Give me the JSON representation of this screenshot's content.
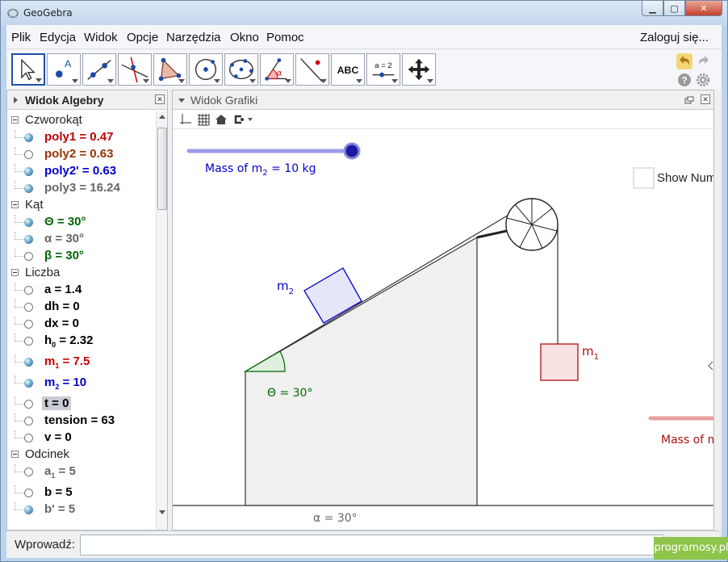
{
  "window": {
    "title": "GeoGebra",
    "minimize_icon": "minimize-icon",
    "maximize_icon": "maximize-icon",
    "close_icon": "close-icon"
  },
  "menu": {
    "items": [
      "Plik",
      "Edycja",
      "Widok",
      "Opcje",
      "Narzędzia",
      "Okno",
      "Pomoc"
    ],
    "login": "Zaloguj się..."
  },
  "toolbar": {
    "tools": [
      {
        "icon": "pointer-arrow-icon"
      },
      {
        "icon": "point-icon",
        "text": "A"
      },
      {
        "icon": "line-icon"
      },
      {
        "icon": "perpendicular-line-icon"
      },
      {
        "icon": "polygon-icon"
      },
      {
        "icon": "circle-center-point-icon"
      },
      {
        "icon": "conic-five-points-icon"
      },
      {
        "icon": "angle-icon",
        "text": "α"
      },
      {
        "icon": "reflect-icon"
      },
      {
        "icon": "text-icon",
        "text": "ABC"
      },
      {
        "icon": "slider-icon",
        "text": "a = 2"
      },
      {
        "icon": "move-view-icon"
      }
    ],
    "undo_icon": "undo-icon",
    "redo_icon": "redo-icon",
    "help_icon": "help-icon",
    "settings_icon": "settings-icon"
  },
  "algebra": {
    "title": "Widok Algebry",
    "categories": [
      {
        "name": "Czworokąt",
        "items": [
          {
            "label": "poly1 = 0.47",
            "color": "#c00000",
            "visible": true
          },
          {
            "label": "poly2 = 0.63",
            "color": "#993300",
            "visible": false
          },
          {
            "label": "poly2' = 0.63",
            "color": "#0000cc",
            "visible": true
          },
          {
            "label": "poly3 = 16.24",
            "color": "#666666",
            "visible": true
          }
        ]
      },
      {
        "name": "Kąt",
        "items": [
          {
            "label": "Θ = 30°",
            "color": "#006600",
            "visible": true
          },
          {
            "label": "α = 30°",
            "color": "#666666",
            "visible": true
          },
          {
            "label": "β = 30°",
            "color": "#006600",
            "visible": false
          }
        ]
      },
      {
        "name": "Liczba",
        "items": [
          {
            "label": "a = 1.4",
            "color": "#000000",
            "visible": false
          },
          {
            "label": "dh = 0",
            "color": "#000000",
            "visible": false
          },
          {
            "label": "dx = 0",
            "color": "#000000",
            "visible": false
          },
          {
            "label": "h",
            "sub": "0",
            "rest": " = 2.32",
            "color": "#000000",
            "visible": false
          },
          {
            "label": "m",
            "sub": "1",
            "rest": " = 7.5",
            "color": "#c00000",
            "visible": true
          },
          {
            "label": "m",
            "sub": "2",
            "rest": " = 10",
            "color": "#0000cc",
            "visible": true
          },
          {
            "label": "t = 0",
            "color": "#000000",
            "visible": false,
            "selected": true
          },
          {
            "label": "tension = 63",
            "color": "#000000",
            "visible": false
          },
          {
            "label": "v = 0",
            "color": "#000000",
            "visible": false
          }
        ]
      },
      {
        "name": "Odcinek",
        "items": [
          {
            "label": "a",
            "sub": "1",
            "rest": " = 5",
            "color": "#666666",
            "visible": false
          },
          {
            "label": "b = 5",
            "color": "#000000",
            "visible": false
          },
          {
            "label": "b' = 5",
            "color": "#666666",
            "visible": true
          }
        ]
      }
    ]
  },
  "graphics": {
    "title": "Widok Grafiki",
    "slider_m2_label": "Mass of m",
    "slider_m2_sub": "2",
    "slider_m2_rest": " = 10 kg",
    "slider_m2_fraction": 1.0,
    "show_num_label": "Show Num",
    "m2_label": "m",
    "m2_sub": "2",
    "m1_label": "m",
    "m1_sub": "1",
    "theta_label": "Θ = 30°",
    "alpha_label": "α = 30°",
    "slider_m1_label": "Mass of m",
    "colors": {
      "blue": "#0000cc",
      "red": "#a11",
      "green": "#006600",
      "slider_blue": "#9b9bea",
      "slider_red": "#e6a0a0"
    }
  },
  "input": {
    "label": "Wprowadź:",
    "value": ""
  },
  "watermark": "programosy.pl"
}
